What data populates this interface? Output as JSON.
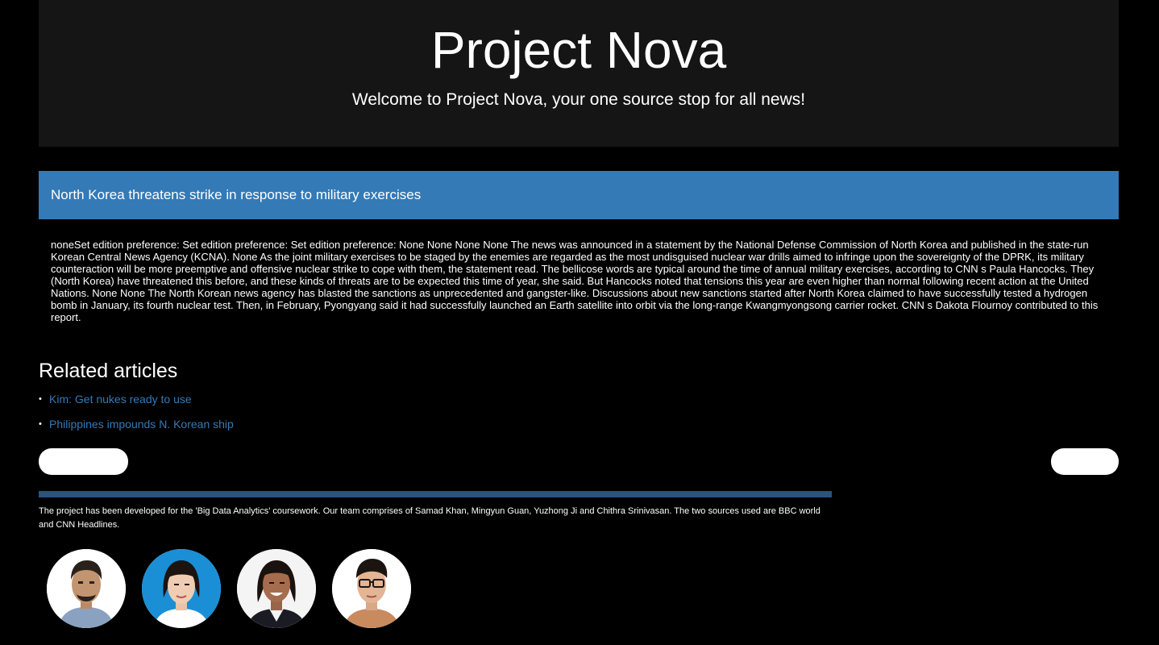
{
  "header": {
    "title": "Project Nova",
    "tagline": "Welcome to Project Nova, your one source stop for all news!"
  },
  "article": {
    "title": "North Korea threatens strike in response to military exercises",
    "body": "noneSet edition preference: Set edition preference: Set edition preference: None None None None The news was announced in a statement by the National Defense Commission of North Korea and published in the state-run Korean Central News Agency (KCNA). None As the joint military exercises to be staged by the enemies are regarded as the most undisguised nuclear war drills aimed to infringe upon the sovereignty of the DPRK, its military counteraction will be more preemptive and offensive nuclear strike to cope with them, the statement read. The bellicose words are typical around the time of annual military exercises, according to CNN s Paula Hancocks. They (North Korea) have threatened this before, and these kinds of threats are to be expected this time of year, she said. But Hancocks noted that tensions this year are even higher than normal following recent action at the United Nations. None None The North Korean news agency has blasted the sanctions as unprecedented and gangster-like. Discussions about new sanctions started after North Korea claimed to have successfully tested a hydrogen bomb in January, its fourth nuclear test. Then, in February, Pyongyang said it had successfully launched an Earth satellite into orbit via the long-range Kwangmyongsong carrier rocket. CNN s Dakota Flournoy contributed to this report."
  },
  "related": {
    "heading": "Related articles",
    "bullet": "•",
    "items": [
      {
        "label": "Kim: Get nukes ready to use"
      },
      {
        "label": "Philippines impounds N. Korean ship"
      }
    ]
  },
  "footer": {
    "text": "The project has been developed for the 'Big Data Analytics' coursework. Our team comprises of Samad Khan, Mingyun Guan, Yuzhong Ji and Chithra Srinivasan. The two sources used are BBC world and CNN Headlines."
  },
  "colors": {
    "background": "#000000",
    "jumbotron": "#151515",
    "panel_heading": "#337ab7",
    "link": "#337ab7",
    "divider": "#2c5282"
  }
}
